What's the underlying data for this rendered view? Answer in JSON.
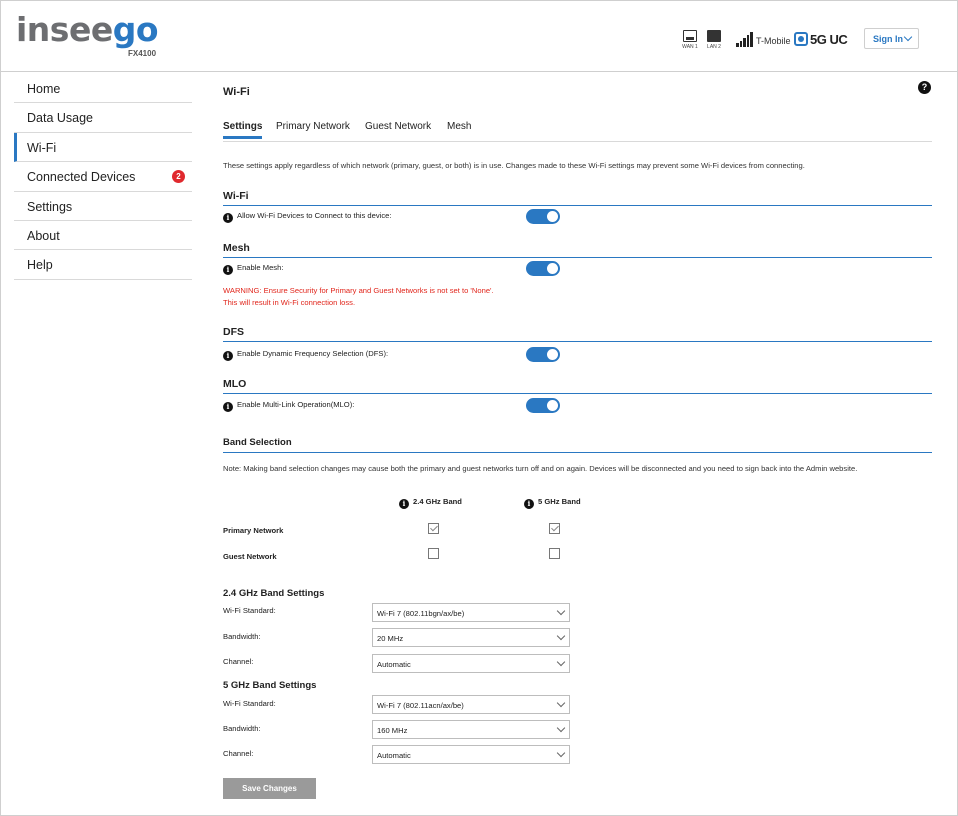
{
  "header": {
    "logo_part1": "insee",
    "logo_part2": "go",
    "model": "FX4100",
    "ports": [
      "WAN 1",
      "LAN 2"
    ],
    "carrier": "T-Mobile",
    "network_type": "5G UC",
    "sign_in_label": "Sign In"
  },
  "sidebar": {
    "items": [
      {
        "label": "Home"
      },
      {
        "label": "Data Usage"
      },
      {
        "label": "Wi-Fi"
      },
      {
        "label": "Connected Devices",
        "badge": "2"
      },
      {
        "label": "Settings"
      },
      {
        "label": "About"
      },
      {
        "label": "Help"
      }
    ]
  },
  "main": {
    "title": "Wi-Fi",
    "help_icon": "?",
    "tabs": [
      "Settings",
      "Primary Network",
      "Guest Network",
      "Mesh"
    ],
    "description": "These settings apply regardless of which network (primary, guest, or both) is in use. Changes made to these Wi-Fi settings may prevent some Wi-Fi devices from connecting.",
    "sections": {
      "wifi": {
        "title": "Wi-Fi",
        "label": "Allow Wi-Fi Devices to Connect to this device:",
        "on": true
      },
      "mesh": {
        "title": "Mesh",
        "label": "Enable Mesh:",
        "on": true,
        "warning_line1": "WARNING: Ensure Security for Primary and Guest Networks is not set to 'None'.",
        "warning_line2": "This will result in Wi-Fi connection loss."
      },
      "dfs": {
        "title": "DFS",
        "label": "Enable Dynamic Frequency Selection (DFS):",
        "on": true
      },
      "mlo": {
        "title": "MLO",
        "label": "Enable Multi-Link Operation(MLO):",
        "on": true
      }
    },
    "band_selection": {
      "title": "Band Selection",
      "note": "Note: Making band selection changes may cause both the primary and guest networks turn off and on again. Devices will be disconnected and you need to sign back into the Admin website.",
      "col_24": "2.4 GHz Band",
      "col_5": "5 GHz Band",
      "rows": [
        {
          "label": "Primary Network",
          "band24": true,
          "band5": true
        },
        {
          "label": "Guest Network",
          "band24": false,
          "band5": false
        }
      ]
    },
    "band24_settings": {
      "title": "2.4 GHz Band Settings",
      "wifi_standard_label": "Wi-Fi Standard:",
      "wifi_standard_value": "Wi-Fi 7 (802.11bgn/ax/be)",
      "bandwidth_label": "Bandwidth:",
      "bandwidth_value": "20 MHz",
      "channel_label": "Channel:",
      "channel_value": "Automatic"
    },
    "band5_settings": {
      "title": "5 GHz Band Settings",
      "wifi_standard_label": "Wi-Fi Standard:",
      "wifi_standard_value": "Wi-Fi 7 (802.11acn/ax/be)",
      "bandwidth_label": "Bandwidth:",
      "bandwidth_value": "160 MHz",
      "channel_label": "Channel:",
      "channel_value": "Automatic"
    },
    "save_label": "Save Changes"
  },
  "colors": {
    "accent": "#2a78c2",
    "warning": "#e1261c",
    "badge": "#e0292e",
    "button_disabled": "#9a9a9a"
  }
}
